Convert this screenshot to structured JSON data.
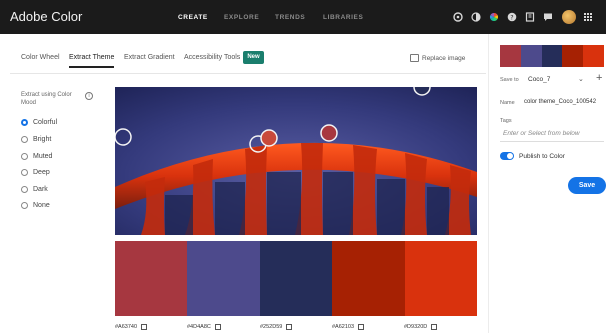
{
  "header": {
    "brand": "Adobe Color",
    "nav": [
      "CREATE",
      "EXPLORE",
      "TRENDS",
      "LIBRARIES"
    ],
    "active_nav": "CREATE",
    "icons": [
      "help-icon",
      "contrast-icon",
      "color-wheel-icon",
      "question-icon",
      "library-icon",
      "chat-icon",
      "avatar",
      "apps-grid-icon"
    ]
  },
  "tabs": {
    "items": [
      "Color Wheel",
      "Extract Theme",
      "Extract Gradient",
      "Accessibility Tools"
    ],
    "active": "Extract Theme",
    "new_badge": "New",
    "replace_image": "Replace image"
  },
  "mood": {
    "title": "Extract using Color Mood",
    "options": [
      "Colorful",
      "Bright",
      "Muted",
      "Deep",
      "Dark",
      "None"
    ],
    "selected": "Colorful"
  },
  "theme": {
    "colors": [
      "#A63740",
      "#4D4A8C",
      "#252D59",
      "#A62103",
      "#D9320D"
    ],
    "labels": [
      "#A63740",
      "#4D4A8C",
      "#252D59",
      "#A62103",
      "#D9320D"
    ]
  },
  "right_panel": {
    "save_to_label": "Save to",
    "save_to_value": "Coco_7",
    "name_label": "Name",
    "name_value": "color theme_Coco_100542",
    "tags_label": "Tags",
    "tags_placeholder": "Enter or Select from below",
    "publish_label": "Publish to Color",
    "publish_on": true,
    "save_label": "Save"
  }
}
